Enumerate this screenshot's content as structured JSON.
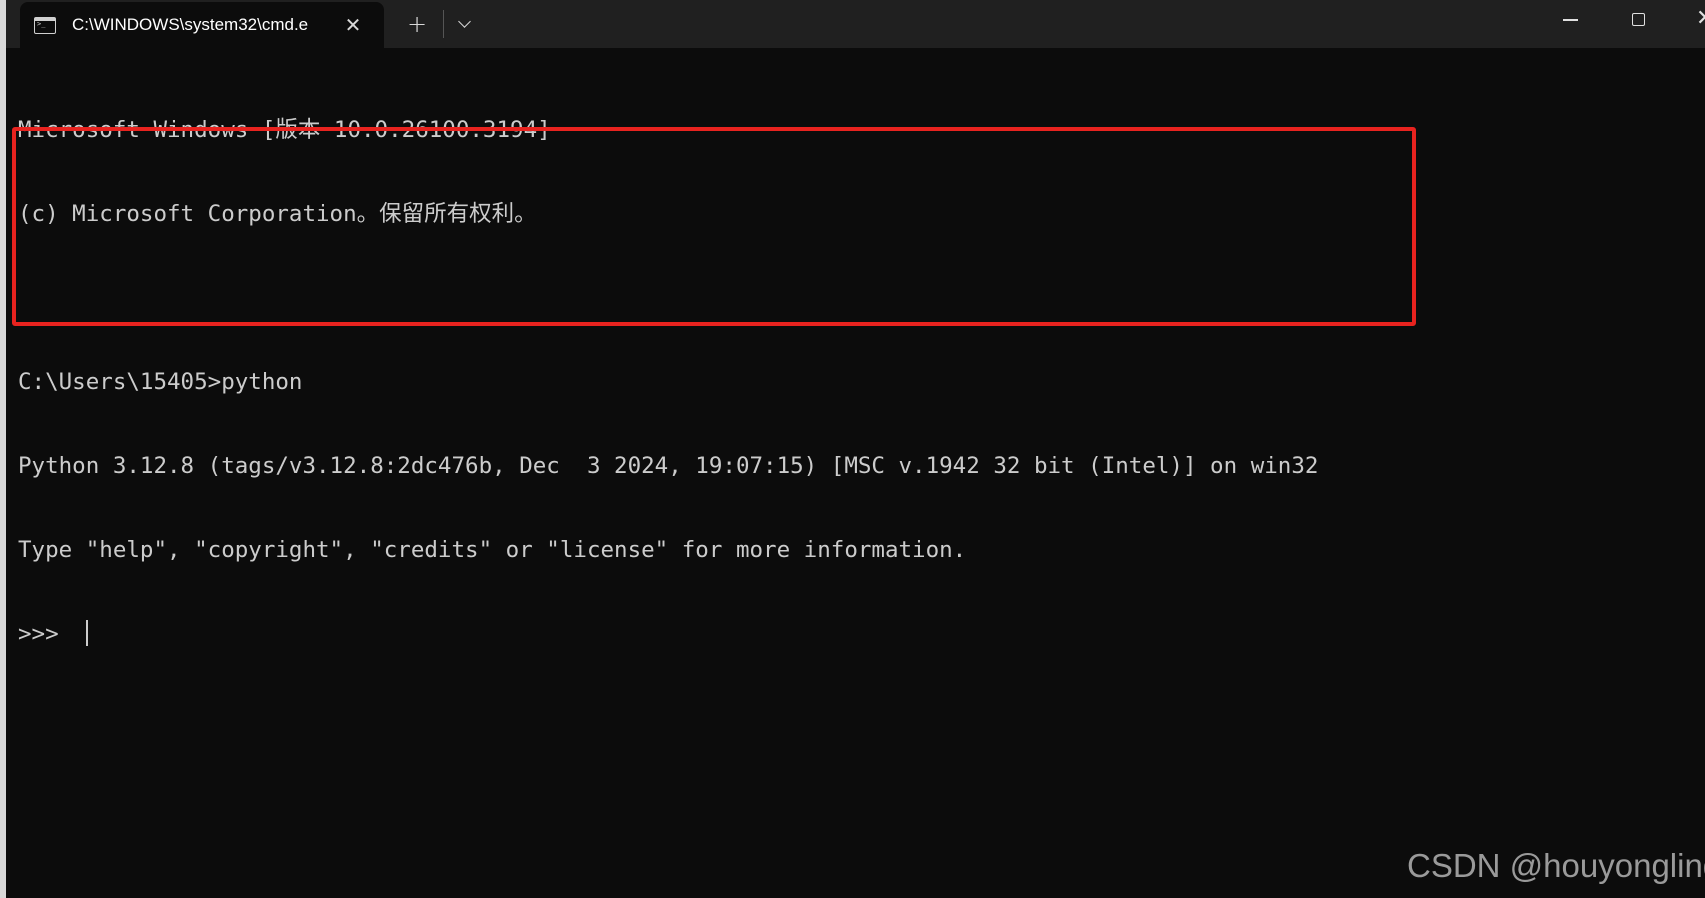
{
  "window": {
    "tab_title": "C:\\WINDOWS\\system32\\cmd.e",
    "tab_icon": "command-prompt-icon",
    "new_tab_label": "+",
    "close_tab_label": "✕"
  },
  "terminal": {
    "lines": [
      "Microsoft Windows [版本 10.0.26100.3194]",
      "(c) Microsoft Corporation。保留所有权利。",
      "",
      "C:\\Users\\15405>python",
      "Python 3.12.8 (tags/v3.12.8:2dc476b, Dec  3 2024, 19:07:15) [MSC v.1942 32 bit (Intel)] on win32",
      "Type \"help\", \"copyright\", \"credits\" or \"license\" for more information.",
      ">>> "
    ],
    "foreground_color": "#cccccc",
    "background_color": "#0c0c0c"
  },
  "annotation": {
    "highlight_color": "#e8231f"
  },
  "watermark": "CSDN @houyongling"
}
